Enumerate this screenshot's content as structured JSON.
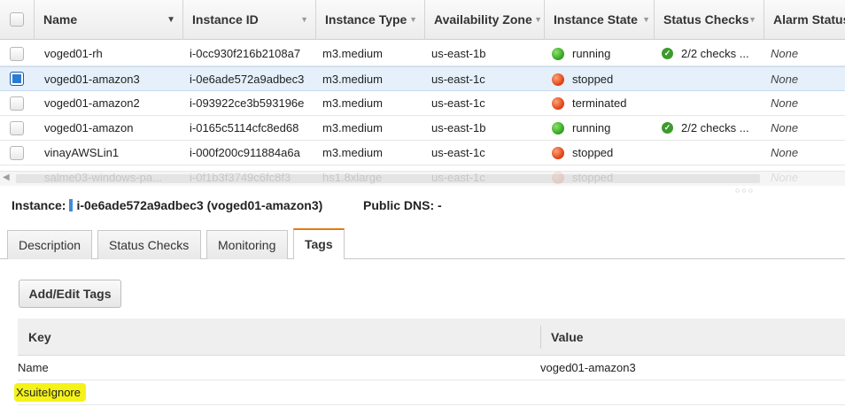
{
  "grid": {
    "columns": [
      "Name",
      "Instance ID",
      "Instance Type",
      "Availability Zone",
      "Instance State",
      "Status Checks",
      "Alarm Status"
    ],
    "rows": [
      {
        "name": "voged01-rh",
        "id": "i-0cc930f216b2108a7",
        "type": "m3.medium",
        "zone": "us-east-1b",
        "state": "running",
        "state_color": "green",
        "checks": "2/2 checks ...",
        "alarm": "None",
        "selected": false
      },
      {
        "name": "voged01-amazon3",
        "id": "i-0e6ade572a9adbec3",
        "type": "m3.medium",
        "zone": "us-east-1c",
        "state": "stopped",
        "state_color": "red",
        "checks": "",
        "alarm": "None",
        "selected": true
      },
      {
        "name": "voged01-amazon2",
        "id": "i-093922ce3b593196e",
        "type": "m3.medium",
        "zone": "us-east-1c",
        "state": "terminated",
        "state_color": "red",
        "checks": "",
        "alarm": "None",
        "selected": false
      },
      {
        "name": "voged01-amazon",
        "id": "i-0165c5114cfc8ed68",
        "type": "m3.medium",
        "zone": "us-east-1b",
        "state": "running",
        "state_color": "green",
        "checks": "2/2 checks ...",
        "alarm": "None",
        "selected": false
      },
      {
        "name": "vinayAWSLin1",
        "id": "i-000f200c911884a6a",
        "type": "m3.medium",
        "zone": "us-east-1c",
        "state": "stopped",
        "state_color": "red",
        "checks": "",
        "alarm": "None",
        "selected": false
      },
      {
        "name": "salme03-windows-pa...",
        "id": "i-0f1b3f3749c6fc8f3",
        "type": "hs1.8xlarge",
        "zone": "us-east-1c",
        "state": "stopped",
        "state_color": "red",
        "checks": "",
        "alarm": "None",
        "selected": false
      }
    ]
  },
  "detail": {
    "instance_label": "Instance:",
    "instance_value": "i-0e6ade572a9adbec3 (voged01-amazon3)",
    "dns_label": "Public DNS:",
    "dns_value": "-"
  },
  "tabs": [
    "Description",
    "Status Checks",
    "Monitoring",
    "Tags"
  ],
  "active_tab": "Tags",
  "tags": {
    "add_button": "Add/Edit Tags",
    "key_header": "Key",
    "value_header": "Value",
    "rows": [
      {
        "key": "Name",
        "value": "voged01-amazon3"
      },
      {
        "key": "XsuiteIgnore",
        "value": ""
      }
    ]
  },
  "colors": {
    "accent_tab": "#e47911",
    "selected_row": "#e5f0fb",
    "highlight": "#f5f218"
  }
}
